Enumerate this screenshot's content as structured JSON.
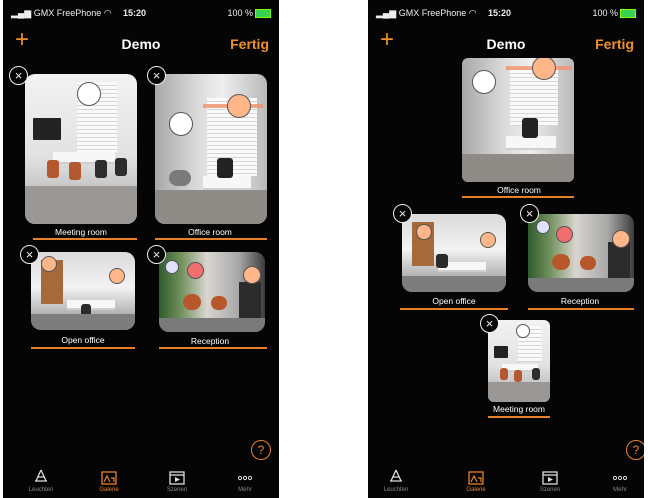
{
  "status_bar": {
    "carrier": "GMX FreePhone",
    "time": "15:20",
    "battery": "100 %"
  },
  "nav": {
    "add_label": "+",
    "title": "Demo",
    "done_label": "Fertig"
  },
  "rooms": {
    "meeting": "Meeting room",
    "office": "Office room",
    "open": "Open office",
    "reception": "Reception"
  },
  "tabs": [
    {
      "label": "Leuchten",
      "icon": "lamp-icon"
    },
    {
      "label": "Galerie",
      "icon": "gallery-icon",
      "active": true
    },
    {
      "label": "Szenen",
      "icon": "scene-icon"
    },
    {
      "label": "Mehr",
      "icon": "more-icon"
    }
  ],
  "help_label": "?",
  "close_label": "×",
  "colors": {
    "accent": "#e8802a",
    "background": "#050505",
    "light_orange": "#ffb688",
    "light_red": "#f06e6e"
  }
}
